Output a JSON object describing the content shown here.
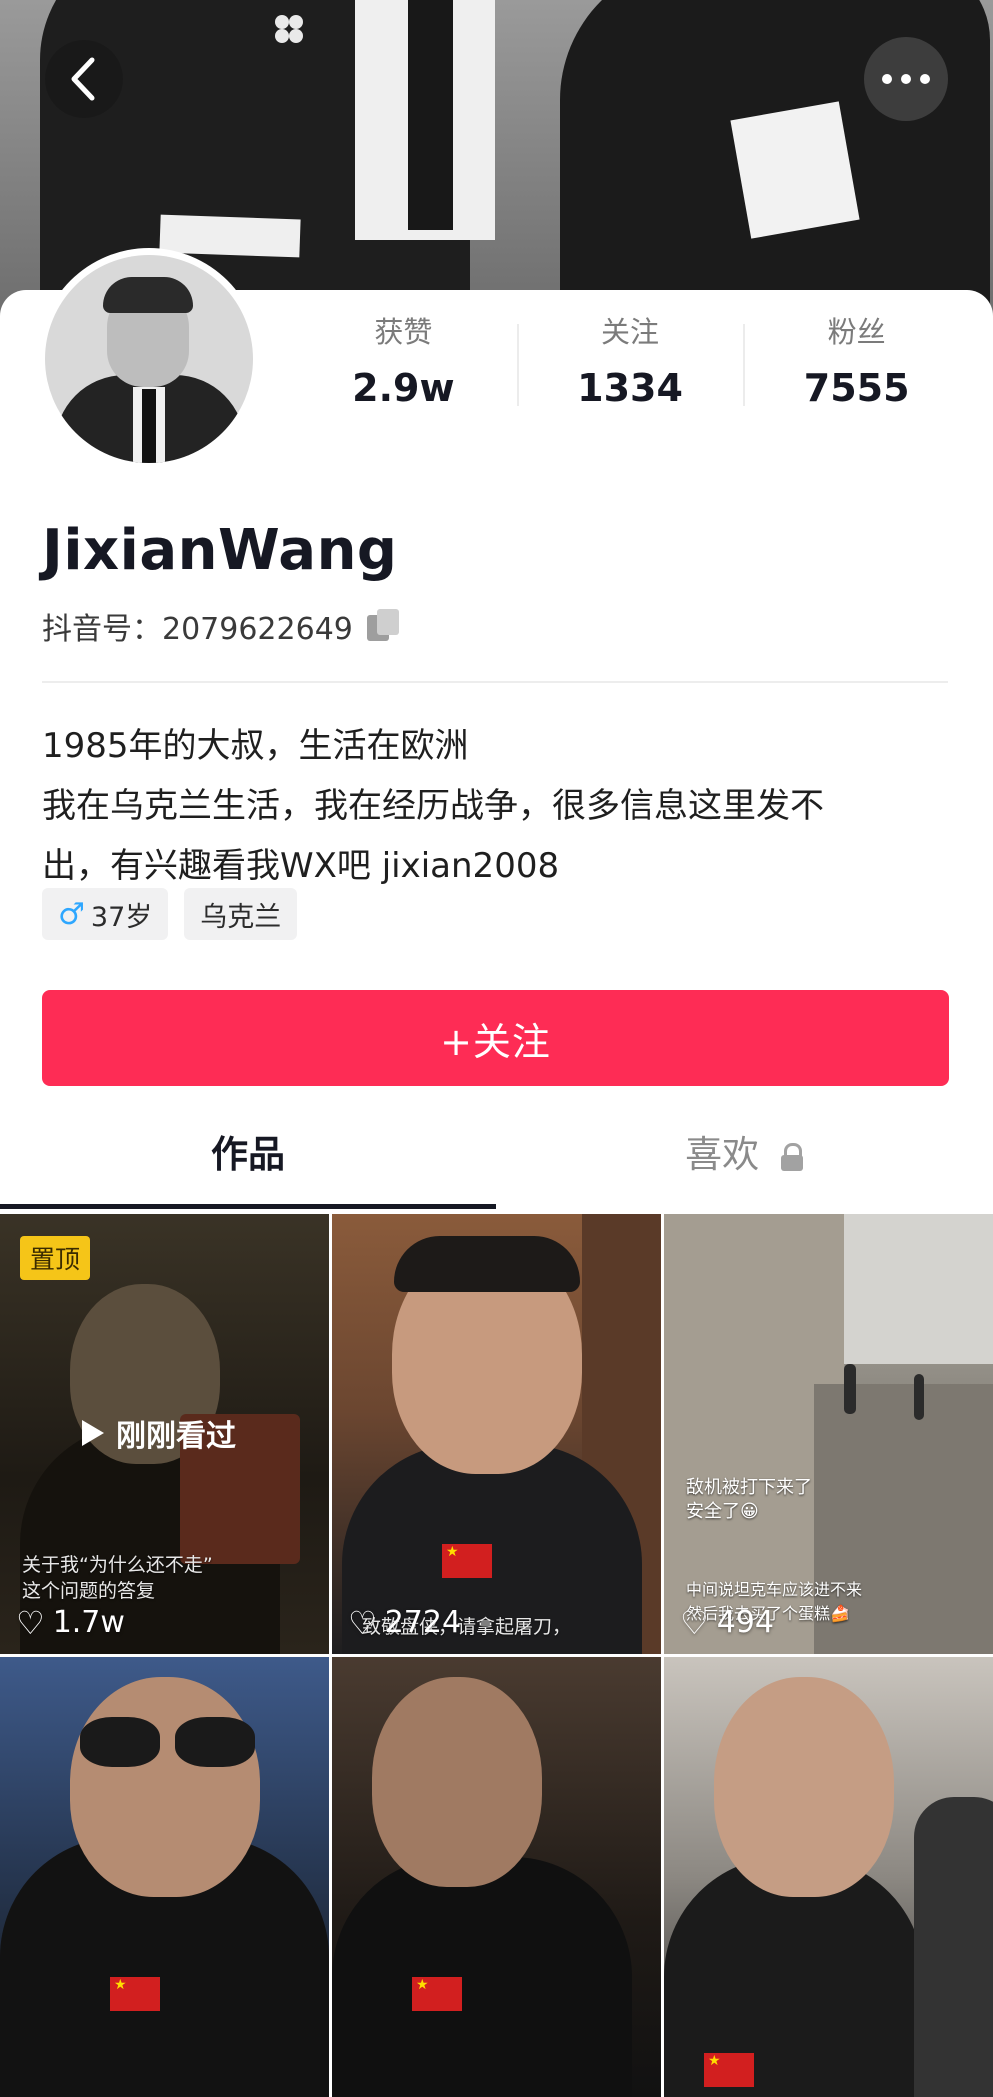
{
  "header": {
    "back_icon": "chevron-left-icon",
    "more_icon": "more-dots-icon"
  },
  "profile": {
    "stats": [
      {
        "label": "获赞",
        "value": "2.9w"
      },
      {
        "label": "关注",
        "value": "1334"
      },
      {
        "label": "粉丝",
        "value": "7555"
      }
    ],
    "name": "JixianWang",
    "douyin_id": "抖音号：2079622649",
    "bio_lines": [
      "1985年的大叔，生活在欧洲",
      "我在乌克兰生活，我在经历战争，很多信息这里发不",
      "出，有兴趣看我WX吧 jixian2008"
    ],
    "tags": {
      "gender_symbol": "♂",
      "age": "37岁",
      "location": "乌克兰"
    },
    "follow_label": "+关注"
  },
  "tabs": [
    {
      "label": "作品",
      "active": true
    },
    {
      "label": "喜欢",
      "active": false,
      "locked": true
    }
  ],
  "videos": [
    {
      "pinned_label": "置顶",
      "recent_label": "刚刚看过",
      "caption_lines": [
        "关于我“为什么还不走”",
        "这个问题的答复"
      ],
      "likes": "1.7w"
    },
    {
      "likes": "2724",
      "caption_lines": [
        "致敬盘侠，请拿起屠刀，"
      ]
    },
    {
      "likes": "494",
      "caption_lines": [
        "敌机被打下来了",
        "安全了😀",
        "中间说坦克车应该进不来",
        "然后我去买了个蛋糕🍰"
      ]
    },
    {
      "likes": ""
    },
    {
      "likes": ""
    },
    {
      "likes": ""
    }
  ],
  "colors": {
    "accent": "#fe2c55",
    "pinned": "#f5c518",
    "gender": "#2ea7ff"
  }
}
